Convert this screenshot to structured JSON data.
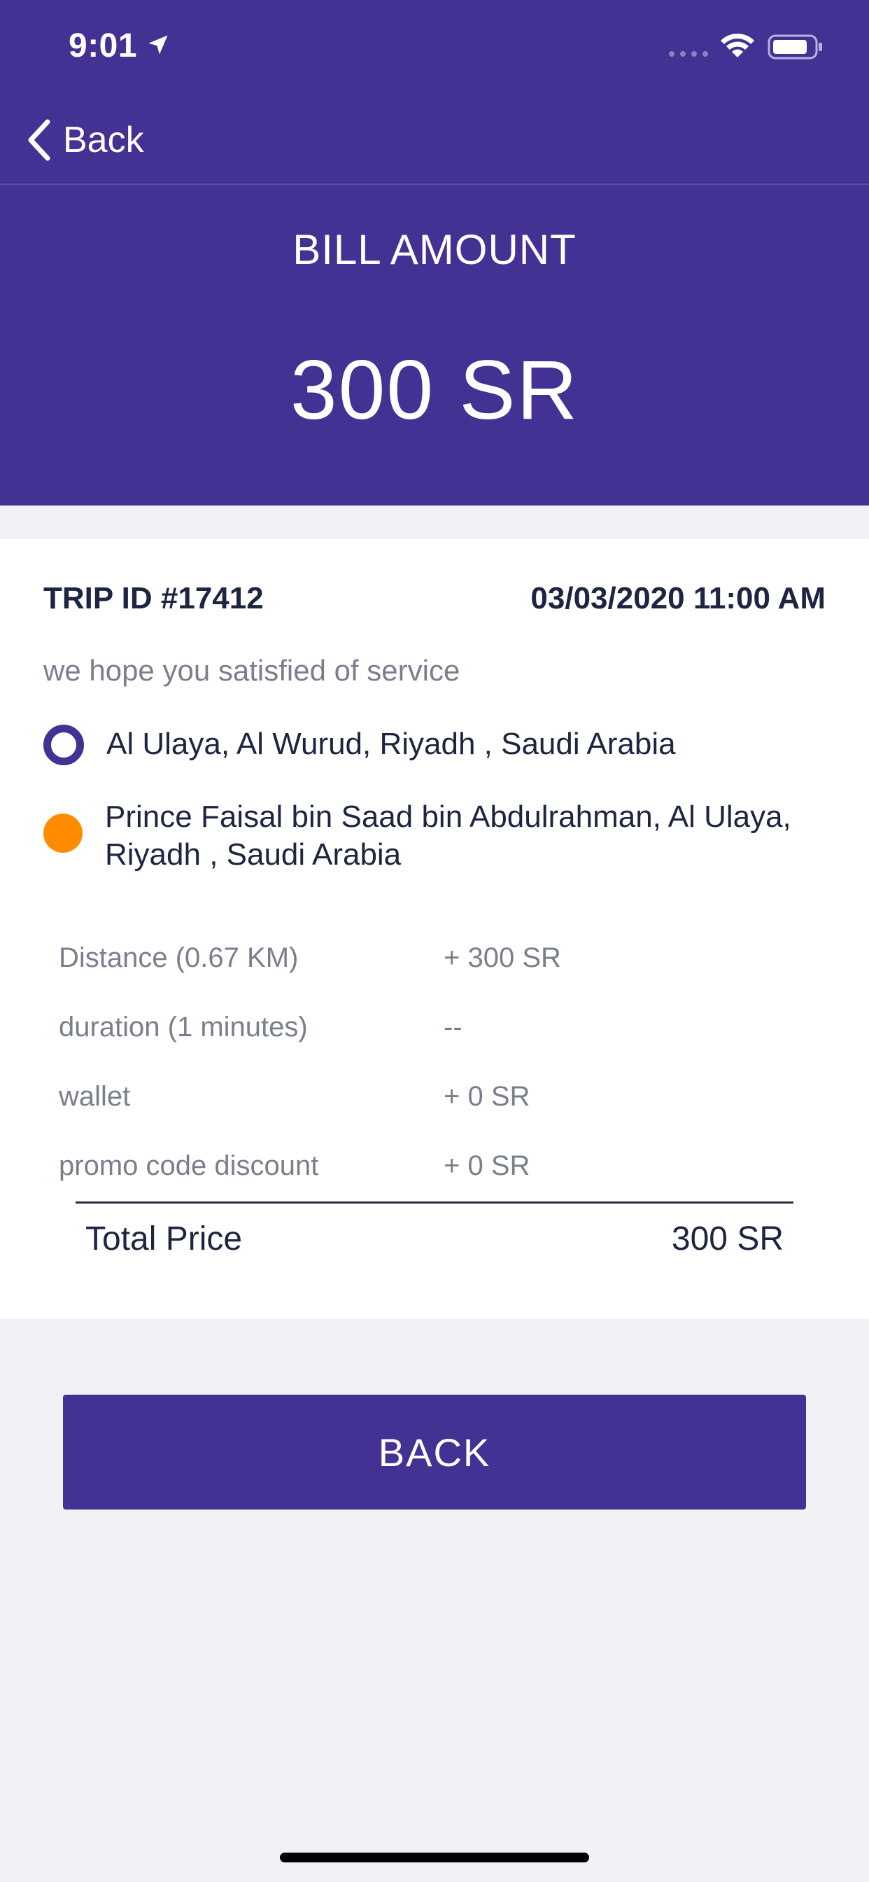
{
  "status_bar": {
    "time": "9:01"
  },
  "nav": {
    "back_label": "Back"
  },
  "header": {
    "title": "BILL AMOUNT",
    "amount": "300 SR"
  },
  "trip": {
    "id_label": "TRIP ID #17412",
    "datetime": "03/03/2020 11:00 AM",
    "message": "we hope you satisfied of service",
    "pickup": "Al Ulaya, Al Wurud, Riyadh  , Saudi Arabia",
    "dropoff": "Prince Faisal bin Saad bin Abdulrahman, Al Ulaya, Riyadh  , Saudi Arabia"
  },
  "fare": {
    "rows": [
      {
        "label": "Distance (0.67 KM)",
        "value": "+ 300 SR"
      },
      {
        "label": "duration (1 minutes)",
        "value": "--"
      },
      {
        "label": "wallet",
        "value": "+ 0 SR"
      },
      {
        "label": "promo code discount",
        "value": "+ 0 SR"
      }
    ],
    "total_label": "Total Price",
    "total_value": "300 SR"
  },
  "actions": {
    "back_button": "BACK"
  },
  "colors": {
    "primary": "#433293",
    "dropoff_accent": "#ff8c00",
    "background": "#f2f2f6"
  },
  "icons": {
    "location": "location-arrow-icon",
    "signal": "cellular-signal-icon",
    "wifi": "wifi-icon",
    "battery": "battery-icon",
    "back": "chevron-left-icon"
  }
}
